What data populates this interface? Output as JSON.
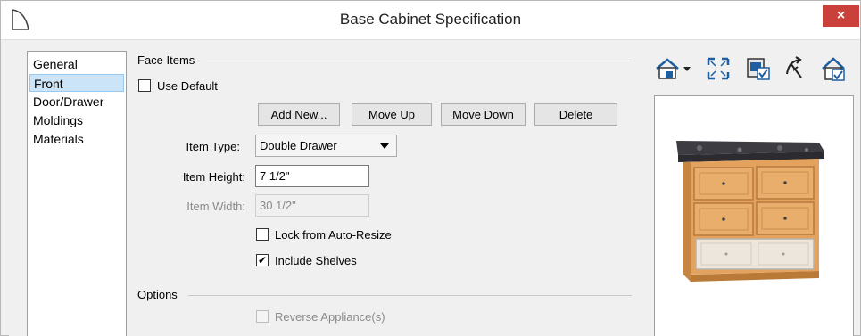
{
  "window": {
    "title": "Base Cabinet Specification",
    "close_label": "×",
    "accent_close": "#c9413a"
  },
  "tabs": [
    {
      "label": "General",
      "selected": false
    },
    {
      "label": "Front",
      "selected": true
    },
    {
      "label": "Door/Drawer",
      "selected": false
    },
    {
      "label": "Moldings",
      "selected": false
    },
    {
      "label": "Materials",
      "selected": false
    }
  ],
  "face_items": {
    "group_label": "Face Items",
    "use_default_label": "Use Default",
    "use_default_checked": false,
    "buttons": {
      "add_new": "Add New...",
      "move_up": "Move Up",
      "move_down": "Move Down",
      "delete": "Delete"
    },
    "item_type_label": "Item Type:",
    "item_type_value": "Double Drawer",
    "item_height_label": "Item Height:",
    "item_height_value": "7 1/2\"",
    "item_width_label": "Item Width:",
    "item_width_value": "30 1/2\"",
    "lock_label": "Lock from Auto-Resize",
    "lock_checked": false,
    "include_shelves_label": "Include Shelves",
    "include_shelves_checked": true,
    "check_mark": "✔"
  },
  "options": {
    "group_label": "Options",
    "reverse_appliance_label": "Reverse Appliance(s)",
    "reverse_appliance_checked": false
  },
  "preview_toolbar": {
    "icons": [
      "view-camera-dropdown-icon",
      "fill-window-icon",
      "render-options-icon",
      "rotate-view-icon",
      "show-in-room-icon"
    ]
  }
}
